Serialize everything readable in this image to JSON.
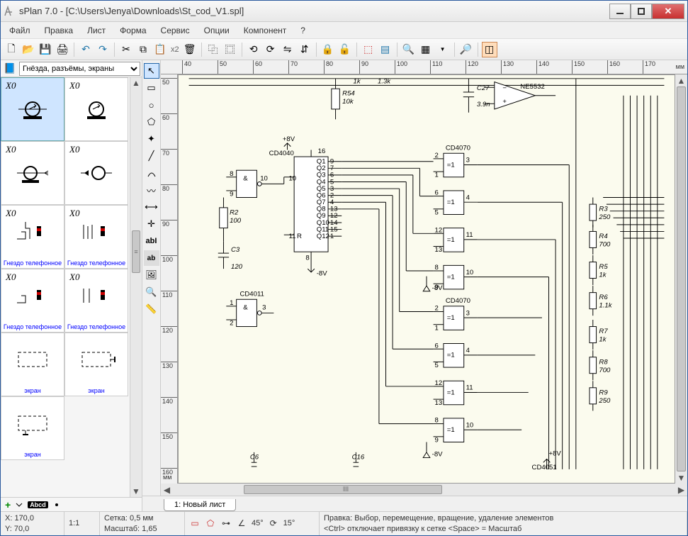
{
  "window": {
    "title": "sPlan 7.0 - [C:\\Users\\Jenya\\Downloads\\St_cod_V1.spl]"
  },
  "menu": {
    "items": [
      "Файл",
      "Правка",
      "Лист",
      "Форма",
      "Сервис",
      "Опции",
      "Компонент",
      "?"
    ]
  },
  "toolbar": {
    "x2": "x2"
  },
  "library": {
    "selector": "Гнёзда, разъёмы, экраны",
    "cells": [
      {
        "tl": "X0",
        "caption": "",
        "selected": true
      },
      {
        "tl": "X0",
        "caption": ""
      },
      {
        "tl": "X0",
        "caption": ""
      },
      {
        "tl": "X0",
        "caption": ""
      },
      {
        "tl": "X0",
        "caption": "Гнездо телефонное"
      },
      {
        "tl": "X0",
        "caption": "Гнездо телефонное"
      },
      {
        "tl": "X0",
        "caption": "Гнездо телефонное"
      },
      {
        "tl": "X0",
        "caption": "Гнездо телефонное"
      },
      {
        "tl": "",
        "caption": "экран"
      },
      {
        "tl": "",
        "caption": "экран"
      },
      {
        "tl": "",
        "caption": "экран"
      }
    ]
  },
  "ruler": {
    "h": [
      "40",
      "50",
      "60",
      "70",
      "80",
      "90",
      "100",
      "110",
      "120",
      "130",
      "140",
      "150",
      "160",
      "170"
    ],
    "v": [
      "50",
      "60",
      "70",
      "80",
      "90",
      "100",
      "110",
      "120",
      "130",
      "140",
      "150",
      "160"
    ],
    "unit": "мм"
  },
  "schematic": {
    "parts": {
      "r54": "R54",
      "r54v": "10k",
      "c27": "C27",
      "c27v": "3.9n",
      "ne5532": "NE5532",
      "v8p": "+8V",
      "v8n": "-8V",
      "cd4040": "CD4040",
      "cd4070a": "CD4070",
      "cd4070b": "CD4070",
      "cd4011": "CD4011",
      "cd4051": "CD4051",
      "r2": "R2",
      "r2v": "100",
      "c3": "C3",
      "c3v": "120",
      "r3": "R3",
      "r3v": "250",
      "r4": "R4",
      "r4v": "700",
      "r5": "R5",
      "r5v": "1k",
      "r6": "R6",
      "r6v": "1.1k",
      "r7": "R7",
      "r7v": "1k",
      "r8": "R8",
      "r8v": "700",
      "r9": "R9",
      "r9v": "250",
      "k1": "1k",
      "k13": "1.3k",
      "c6": "C6",
      "c16": "C16",
      "and": "&",
      "eq1": "=1",
      "pin1": "1",
      "pin2": "2",
      "pin3": "3",
      "pin4": "4",
      "pin5": "5",
      "pin6": "6",
      "pin7": "7",
      "pin8": "8",
      "pin9": "9",
      "pin10": "10",
      "pin11": "11",
      "pin12": "12",
      "pin13": "13",
      "pin14": "14",
      "pin15": "15",
      "pin16": "16",
      "q1": "Q1",
      "q2": "Q2",
      "q3": "Q3",
      "q4": "Q4",
      "q5": "Q5",
      "q6": "Q6",
      "q7": "Q7",
      "q8": "Q8",
      "q9": "Q9",
      "q10": "Q10",
      "q11": "Q11",
      "q12": "Q12",
      "resetR": "R"
    }
  },
  "tabs": {
    "sheet1": "1: Новый лист"
  },
  "status": {
    "coord_x": "X: 170,0",
    "coord_y": "Y: 70,0",
    "zoom": "1:1",
    "grid": "Сетка: 0,5 мм",
    "scale": "Масштаб:  1,65",
    "angle1": "45°",
    "angle2": "15°",
    "help1": "Правка: Выбор, перемещение, вращение, удаление элементов",
    "help2": "<Ctrl> отключает привязку к сетке <Space> = Масштаб"
  }
}
